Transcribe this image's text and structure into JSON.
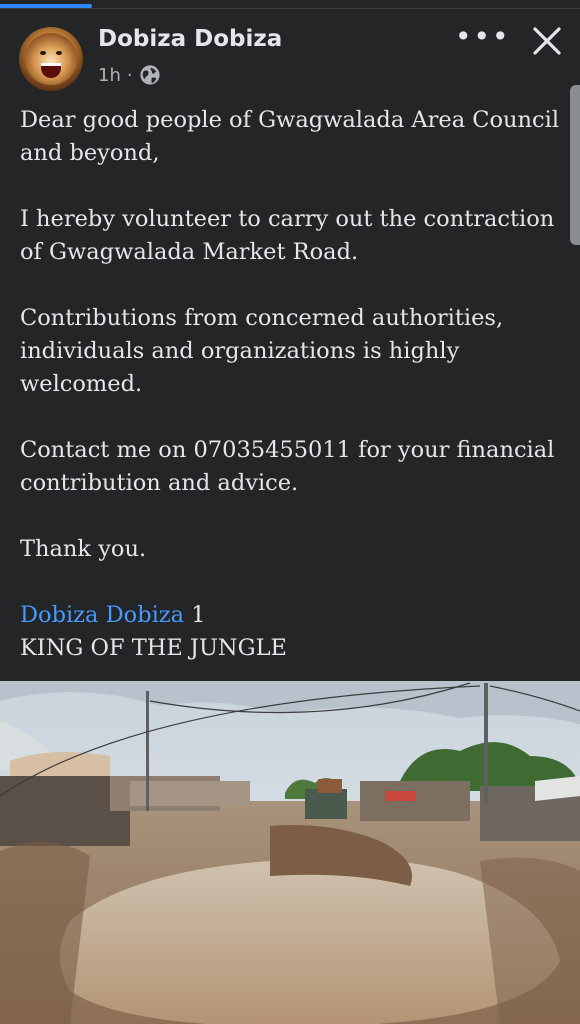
{
  "post": {
    "author": "Dobiza Dobiza",
    "time": "1h",
    "separator": "·",
    "paragraphs": [
      "Dear good people of Gwagwalada Area Council and beyond,",
      "I hereby volunteer to carry out the contraction of Gwagwalada Market Road.",
      "Contributions from concerned authorities, individuals and organizations is highly welcomed.",
      "Contact me on 07035455011 for your financial contribution and advice.",
      "Thank you."
    ],
    "signature_link": "Dobiza Dobiza",
    "signature_suffix": " 1",
    "signature_title": "KING OF THE  JUNGLE"
  },
  "icons": {
    "avatar": "lion-avatar",
    "privacy": "globe-icon",
    "menu": "more-options-icon",
    "close": "close-icon"
  },
  "colors": {
    "background": "#242526",
    "text": "#e4e6eb",
    "secondary_text": "#b0b3b8",
    "link": "#4599ff",
    "progress": "#2d88ff"
  },
  "more_label": "•••"
}
